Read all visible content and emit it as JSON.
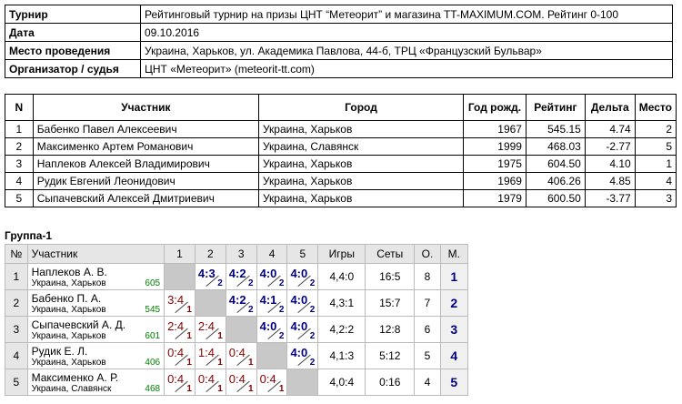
{
  "info": [
    {
      "key": "Турнир",
      "value": "Рейтинговый турнир на призы ЦНТ “Метеорит” и магазина TT-MAXIMUM.COM. Рейтинг 0-100"
    },
    {
      "key": "Дата",
      "value": "09.10.2016"
    },
    {
      "key": "Место проведения",
      "value": "Украина, Харьков, ул. Академика Павлова, 44-б, ТРЦ «Французский Бульвар»"
    },
    {
      "key": "Организатор / судья",
      "value": "ЦНТ «Метеорит» (meteorit-tt.com)"
    }
  ],
  "participants": {
    "headers": [
      "N",
      "Участник",
      "Город",
      "Год рожд.",
      "Рейтинг",
      "Дельта",
      "Место"
    ],
    "rows": [
      [
        "1",
        "Бабенко Павел Алексеевич",
        "Украина, Харьков",
        "1967",
        "545.15",
        "4.74",
        "2"
      ],
      [
        "2",
        "Максименко Артем Романович",
        "Украина, Славянск",
        "1999",
        "468.03",
        "-2.77",
        "5"
      ],
      [
        "3",
        "Наплеков Алексей Владимирович",
        "Украина, Харьков",
        "1975",
        "604.50",
        "4.10",
        "1"
      ],
      [
        "4",
        "Рудик Евгений Леонидович",
        "Украина, Харьков",
        "1969",
        "406.26",
        "4.85",
        "4"
      ],
      [
        "5",
        "Сыпачевский Алексей Дмитриевич",
        "Украина, Харьков",
        "1979",
        "600.50",
        "-3.77",
        "3"
      ]
    ]
  },
  "group": {
    "title": "Группа-1",
    "headers": [
      "№",
      "Участник",
      "1",
      "2",
      "3",
      "4",
      "5",
      "Игры",
      "Сеты",
      "О.",
      "М."
    ],
    "rows": [
      {
        "n": "1",
        "name": "Наплеков А. В.",
        "city": "Украина, Харьков",
        "rating": "605",
        "cells": [
          null,
          {
            "s": "4:3",
            "p": "2",
            "w": true
          },
          {
            "s": "4:2",
            "p": "2",
            "w": true
          },
          {
            "s": "4:0",
            "p": "2",
            "w": true
          },
          {
            "s": "4:0",
            "p": "2",
            "w": true
          }
        ],
        "games": "4,4:0",
        "sets": "16:5",
        "points": "8",
        "place": "1"
      },
      {
        "n": "2",
        "name": "Бабенко П. А.",
        "city": "Украина, Харьков",
        "rating": "545",
        "cells": [
          {
            "s": "3:4",
            "p": "1",
            "w": false
          },
          null,
          {
            "s": "4:2",
            "p": "2",
            "w": true
          },
          {
            "s": "4:1",
            "p": "2",
            "w": true
          },
          {
            "s": "4:0",
            "p": "2",
            "w": true
          }
        ],
        "games": "4,3:1",
        "sets": "15:7",
        "points": "7",
        "place": "2"
      },
      {
        "n": "3",
        "name": "Сыпачевский А. Д.",
        "city": "Украина, Харьков",
        "rating": "601",
        "cells": [
          {
            "s": "2:4",
            "p": "1",
            "w": false
          },
          {
            "s": "2:4",
            "p": "1",
            "w": false
          },
          null,
          {
            "s": "4:0",
            "p": "2",
            "w": true
          },
          {
            "s": "4:0",
            "p": "2",
            "w": true
          }
        ],
        "games": "4,2:2",
        "sets": "12:8",
        "points": "6",
        "place": "3"
      },
      {
        "n": "4",
        "name": "Рудик Е. Л.",
        "city": "Украина, Харьков",
        "rating": "406",
        "cells": [
          {
            "s": "0:4",
            "p": "1",
            "w": false
          },
          {
            "s": "1:4",
            "p": "1",
            "w": false
          },
          {
            "s": "0:4",
            "p": "1",
            "w": false
          },
          null,
          {
            "s": "4:0",
            "p": "2",
            "w": true
          }
        ],
        "games": "4,1:3",
        "sets": "5:12",
        "points": "5",
        "place": "4"
      },
      {
        "n": "5",
        "name": "Максименко А. Р.",
        "city": "Украина, Славянск",
        "rating": "468",
        "cells": [
          {
            "s": "0:4",
            "p": "1",
            "w": false
          },
          {
            "s": "0:4",
            "p": "1",
            "w": false
          },
          {
            "s": "0:4",
            "p": "1",
            "w": false
          },
          {
            "s": "0:4",
            "p": "1",
            "w": false
          },
          null
        ],
        "games": "4,0:4",
        "sets": "0:16",
        "points": "4",
        "place": "5"
      }
    ]
  }
}
